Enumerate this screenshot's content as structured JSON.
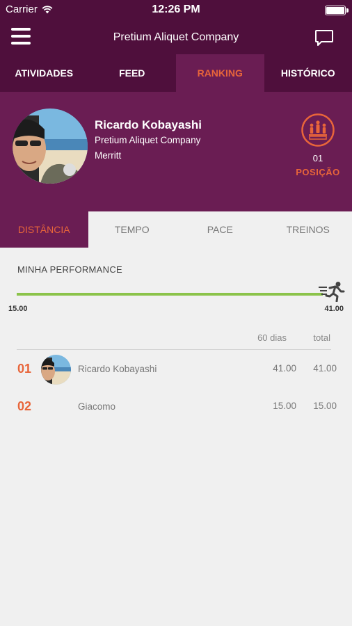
{
  "status": {
    "carrier": "Carrier",
    "time": "12:26 PM"
  },
  "header": {
    "title": "Pretium Aliquet Company"
  },
  "tabs": [
    {
      "label": "ATIVIDADES"
    },
    {
      "label": "FEED"
    },
    {
      "label": "RANKING"
    },
    {
      "label": "HISTÓRICO"
    }
  ],
  "profile": {
    "name": "Ricardo Kobayashi",
    "company": "Pretium Aliquet Company",
    "city": "Merritt",
    "position_number": "01",
    "position_label": "POSIÇÃO"
  },
  "subtabs": [
    {
      "label": "DISTÂNCIA"
    },
    {
      "label": "TEMPO"
    },
    {
      "label": "PACE"
    },
    {
      "label": "TREINOS"
    }
  ],
  "performance": {
    "label": "MINHA PERFORMANCE",
    "min": "15.00",
    "max": "41.00",
    "progress": 1.0
  },
  "ranking": {
    "columns": {
      "period": "60 dias",
      "total": "total"
    },
    "rows": [
      {
        "rank": "01",
        "name": "Ricardo Kobayashi",
        "period": "41.00",
        "total": "41.00"
      },
      {
        "rank": "02",
        "name": "Giacomo",
        "period": "15.00",
        "total": "15.00"
      }
    ]
  },
  "colors": {
    "header_bg": "#4f0f3c",
    "profile_bg": "#6a1d53",
    "accent": "#e8653a",
    "progress": "#8bc34a"
  },
  "icons": [
    "wifi-icon",
    "battery-icon",
    "hamburger-menu-icon",
    "chat-bubble-icon",
    "podium-icon",
    "runner-icon"
  ]
}
